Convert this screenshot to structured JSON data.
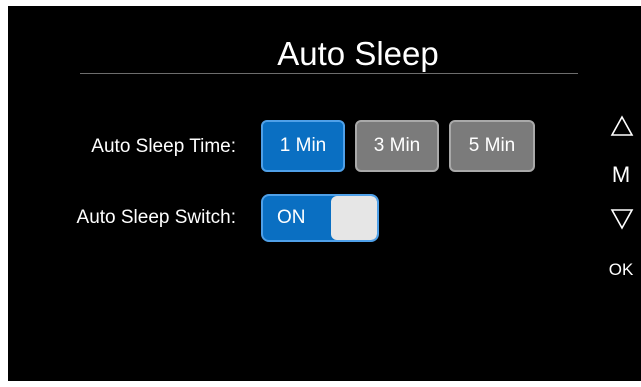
{
  "title": "Auto Sleep",
  "auto_sleep_time": {
    "label": "Auto Sleep Time:",
    "options": [
      {
        "label": "1 Min",
        "selected": true
      },
      {
        "label": "3 Min",
        "selected": false
      },
      {
        "label": "5 Min",
        "selected": false
      }
    ]
  },
  "auto_sleep_switch": {
    "label": "Auto Sleep Switch:",
    "state_label": "ON",
    "on": true
  },
  "side_keys": {
    "up": "up-triangle-icon",
    "menu_label": "M",
    "down": "down-triangle-icon",
    "ok_label": "OK"
  },
  "colors": {
    "selected": "#0a6fc2",
    "unselected": "#7b7b7b",
    "background": "#000000"
  }
}
